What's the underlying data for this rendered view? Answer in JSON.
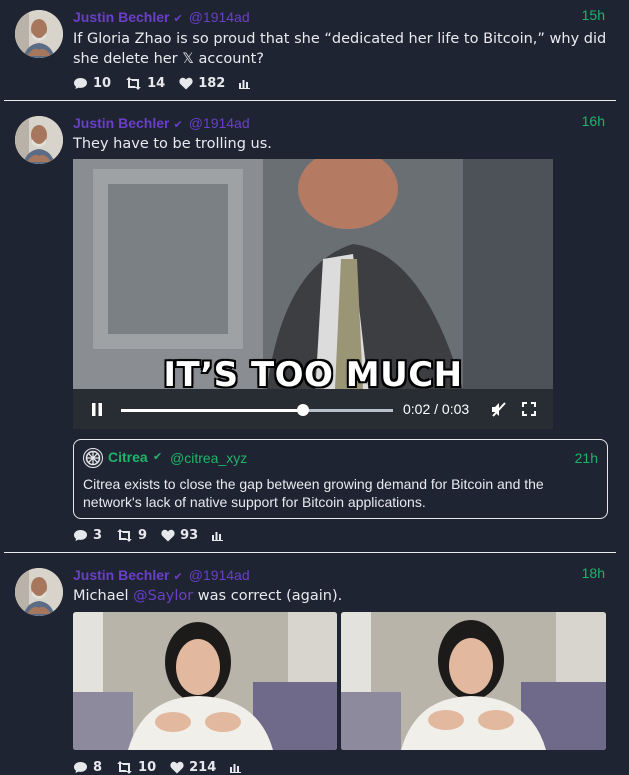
{
  "tweets": [
    {
      "author": "Justin Bechler",
      "verified_mark": "✔",
      "handle": "@1914ad",
      "time": "15h",
      "text": "If Gloria Zhao is so proud that she “dedicated her life to Bitcoin,” why did she delete her 𝕏 account?",
      "replies": "10",
      "retweets": "14",
      "likes": "182"
    },
    {
      "author": "Justin Bechler",
      "verified_mark": "✔",
      "handle": "@1914ad",
      "time": "16h",
      "text": "They have to be trolling us.",
      "video": {
        "caption": "IT’S TOO MUCH",
        "time_display": "0:02 / 0:03",
        "progress_fraction": 0.67
      },
      "quote": {
        "author": "Citrea",
        "verified_mark": "✔",
        "handle": "@citrea_xyz",
        "time": "21h",
        "text": "Citrea exists to close the gap between growing demand for Bitcoin and the network's lack of native support for Bitcoin applications."
      },
      "replies": "3",
      "retweets": "9",
      "likes": "93"
    },
    {
      "author": "Justin Bechler",
      "verified_mark": "✔",
      "handle": "@1914ad",
      "time": "18h",
      "text_before": "Michael ",
      "mention": "@Saylor",
      "text_after": " was correct (again).",
      "replies": "8",
      "retweets": "10",
      "likes": "214"
    }
  ],
  "colors": {
    "background": "#1e2431",
    "author": "#6b3fc8",
    "time": "#1fb46a",
    "quote_accent": "#1fb46a"
  },
  "icons": [
    "comment-icon",
    "retweet-icon",
    "heart-icon",
    "stats-icon",
    "pause-icon",
    "mute-icon",
    "fullscreen-icon",
    "verified-icon",
    "citrea-logo-icon"
  ]
}
